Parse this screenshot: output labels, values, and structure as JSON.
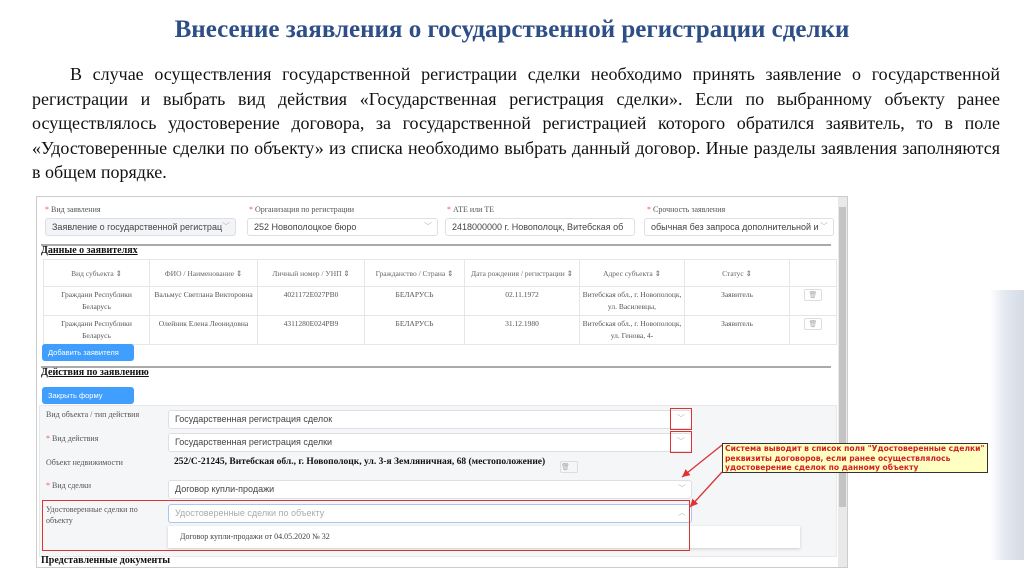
{
  "slide": {
    "title": "Внесение заявления о государственной регистрации сделки",
    "paragraph": "В случае осуществления государственной регистрации сделки необходимо  принять заявление о государственной регистрации и выбрать вид действия «Государственная регистрация сделки». Если по выбранному объекту ранее осуществлялось удостоверение договора, за государственной регистрацией которого обратился заявитель, то в поле «Удостоверенные сделки по объекту» из списка необходимо выбрать данный договор. Иные разделы заявления заполняются в общем порядке."
  },
  "header_fields": [
    {
      "label": "Вид заявления",
      "value": "Заявление о государственной регистрац"
    },
    {
      "label": "Организация по регистрации",
      "value": "252 Новополоцкое бюро"
    },
    {
      "label": "АТЕ или ТЕ",
      "value": "2418000000 г. Новополоцк, Витебская об"
    },
    {
      "label": "Срочность заявления",
      "value": "обычная без запроса дополнительной и"
    }
  ],
  "applicants": {
    "title": "Данные о заявителях",
    "columns": [
      "Вид субъекта ⇕",
      "ФИО / Наименование ⇕",
      "Личный номер / УНП ⇕",
      "Гражданство / Страна ⇕",
      "Дата рождения / регистрации ⇕",
      "Адрес субъекта ⇕",
      "Статус ⇕",
      ""
    ],
    "rows": [
      [
        "Граждани Республики Беларусь",
        "Вальмус Светлана Викторовна",
        "4021172E027PB0",
        "БЕЛАРУСЬ",
        "02.11.1972",
        "Витебская обл., г. Новополоцк, ул. Василевцы,",
        "Заявитель"
      ],
      [
        "Граждани Республики Беларусь",
        "Олейник Елена Леонидовна",
        "4311280E024PB9",
        "БЕЛАРУСЬ",
        "31.12.1980",
        "Витебская обл., г. Новополоцк, ул. Генова, 4-",
        "Заявитель"
      ]
    ],
    "add_button": "Добавить заявителя"
  },
  "actions": {
    "title": "Действия по заявлению",
    "close_button": "Закрыть форму",
    "object_type_label": "Вид объекта / тип действия",
    "object_type_value": "Государственная регистрация сделок",
    "action_label": "Вид действия",
    "action_value": "Государственная регистрация сделки",
    "property_label": "Объект недвижимости",
    "property_value": "252/С-21245, Витебская обл., г. Новополоцк, ул. 3-я Земляничная, 68 (местоположение)",
    "deal_label": "Вид сделки",
    "deal_value": "Договор купли-продажи",
    "certified_label": "Удостоверенные сделки по объекту",
    "certified_placeholder": "Удостоверенные сделки по объекту",
    "dropdown_option": "Договор купли-продажи от 04.05.2020 № 32"
  },
  "next_section": "Представленные документы",
  "callout": "Система выводит в список поля \"Удостоверенные сделки\" реквизиты договоров, если ранее осуществлялось удостоверение сделок по данному объекту",
  "colors": {
    "title": "#2d4e86",
    "button": "#409eff",
    "highlight": "#d33333"
  }
}
